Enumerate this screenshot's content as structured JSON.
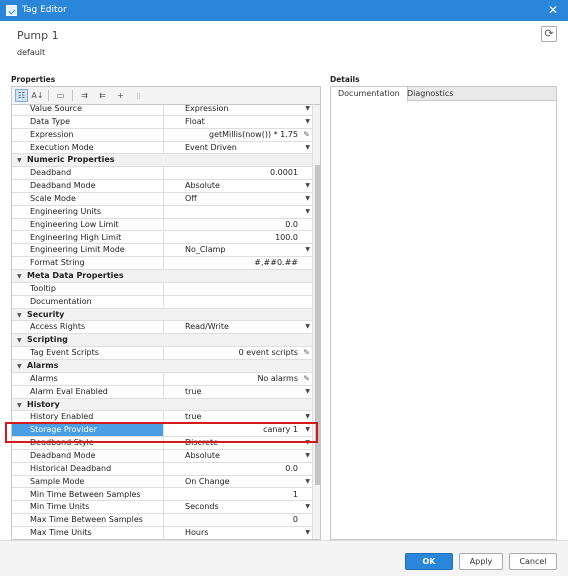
{
  "window": {
    "title": "Tag Editor",
    "close_glyph": "✕",
    "app_icon": "tag-editor-icon"
  },
  "header": {
    "tag_name": "Pump 1",
    "provider": "default",
    "refresh_icon": "refresh-icon"
  },
  "properties": {
    "title": "Properties",
    "toolbar_icons": [
      "categorized-view-icon",
      "sort-alpha-icon",
      "tag-icon",
      "expand-all-icon",
      "collapse-all-icon",
      "add-icon",
      "delete-icon"
    ],
    "rows": [
      {
        "type": "prop",
        "label": "Value Source",
        "value": "Expression",
        "align": "left",
        "control": "dropdown"
      },
      {
        "type": "prop",
        "label": "Data Type",
        "value": "Float",
        "align": "left",
        "control": "dropdown"
      },
      {
        "type": "prop",
        "label": "Expression",
        "value": "getMillis(now()) * 1.75",
        "align": "right",
        "control": "edit"
      },
      {
        "type": "prop",
        "label": "Execution Mode",
        "value": "Event Driven",
        "align": "left",
        "control": "dropdown"
      },
      {
        "type": "category",
        "label": "Numeric Properties"
      },
      {
        "type": "prop",
        "label": "Deadband",
        "value": "0.0001",
        "align": "right",
        "control": "none"
      },
      {
        "type": "prop",
        "label": "Deadband Mode",
        "value": "Absolute",
        "align": "left",
        "control": "dropdown"
      },
      {
        "type": "prop",
        "label": "Scale Mode",
        "value": "Off",
        "align": "left",
        "control": "dropdown"
      },
      {
        "type": "prop",
        "label": "Engineering Units",
        "value": "",
        "align": "left",
        "control": "dropdown"
      },
      {
        "type": "prop",
        "label": "Engineering Low Limit",
        "value": "0.0",
        "align": "right",
        "control": "none"
      },
      {
        "type": "prop",
        "label": "Engineering High Limit",
        "value": "100.0",
        "align": "right",
        "control": "none"
      },
      {
        "type": "prop",
        "label": "Engineering Limit Mode",
        "value": "No_Clamp",
        "align": "left",
        "control": "dropdown"
      },
      {
        "type": "prop",
        "label": "Format String",
        "value": "#,##0.##",
        "align": "right",
        "control": "none"
      },
      {
        "type": "category",
        "label": "Meta Data Properties"
      },
      {
        "type": "prop",
        "label": "Tooltip",
        "value": "",
        "align": "left",
        "control": "none"
      },
      {
        "type": "prop",
        "label": "Documentation",
        "value": "",
        "align": "left",
        "control": "none"
      },
      {
        "type": "category",
        "label": "Security"
      },
      {
        "type": "prop",
        "label": "Access Rights",
        "value": "Read/Write",
        "align": "left",
        "control": "dropdown"
      },
      {
        "type": "category",
        "label": "Scripting"
      },
      {
        "type": "prop",
        "label": "Tag Event Scripts",
        "value": "0 event scripts",
        "align": "right",
        "control": "edit"
      },
      {
        "type": "category",
        "label": "Alarms"
      },
      {
        "type": "prop",
        "label": "Alarms",
        "value": "No alarms",
        "align": "right",
        "control": "edit"
      },
      {
        "type": "prop",
        "label": "Alarm Eval Enabled",
        "value": "true",
        "align": "left",
        "control": "dropdown"
      },
      {
        "type": "category",
        "label": "History"
      },
      {
        "type": "prop",
        "label": "History Enabled",
        "value": "true",
        "align": "left",
        "control": "dropdown"
      },
      {
        "type": "prop",
        "label": "Storage Provider",
        "value": "canary 1",
        "align": "right",
        "control": "dropdown",
        "selected": true
      },
      {
        "type": "prop",
        "label": "Deadband Style",
        "value": "Discrete",
        "align": "left",
        "control": "dropdown"
      },
      {
        "type": "prop",
        "label": "Deadband Mode",
        "value": "Absolute",
        "align": "left",
        "control": "dropdown"
      },
      {
        "type": "prop",
        "label": "Historical Deadband",
        "value": "0.0",
        "align": "right",
        "control": "none"
      },
      {
        "type": "prop",
        "label": "Sample Mode",
        "value": "On Change",
        "align": "left",
        "control": "dropdown"
      },
      {
        "type": "prop",
        "label": "Min Time Between Samples",
        "value": "1",
        "align": "right",
        "control": "none"
      },
      {
        "type": "prop",
        "label": "Min Time Units",
        "value": "Seconds",
        "align": "left",
        "control": "dropdown"
      },
      {
        "type": "prop",
        "label": "Max Time Between Samples",
        "value": "0",
        "align": "right",
        "control": "none"
      },
      {
        "type": "prop",
        "label": "Max Time Units",
        "value": "Hours",
        "align": "left",
        "control": "dropdown"
      }
    ]
  },
  "details": {
    "title": "Details",
    "tabs": [
      {
        "label": "Documentation",
        "active": true
      },
      {
        "label": "Diagnostics",
        "active": false
      }
    ]
  },
  "footer": {
    "ok_label": "OK",
    "apply_label": "Apply",
    "cancel_label": "Cancel"
  },
  "colors": {
    "accent": "#2a86d8",
    "selection": "#4a9ee4",
    "highlight_box": "#d21b1b"
  }
}
